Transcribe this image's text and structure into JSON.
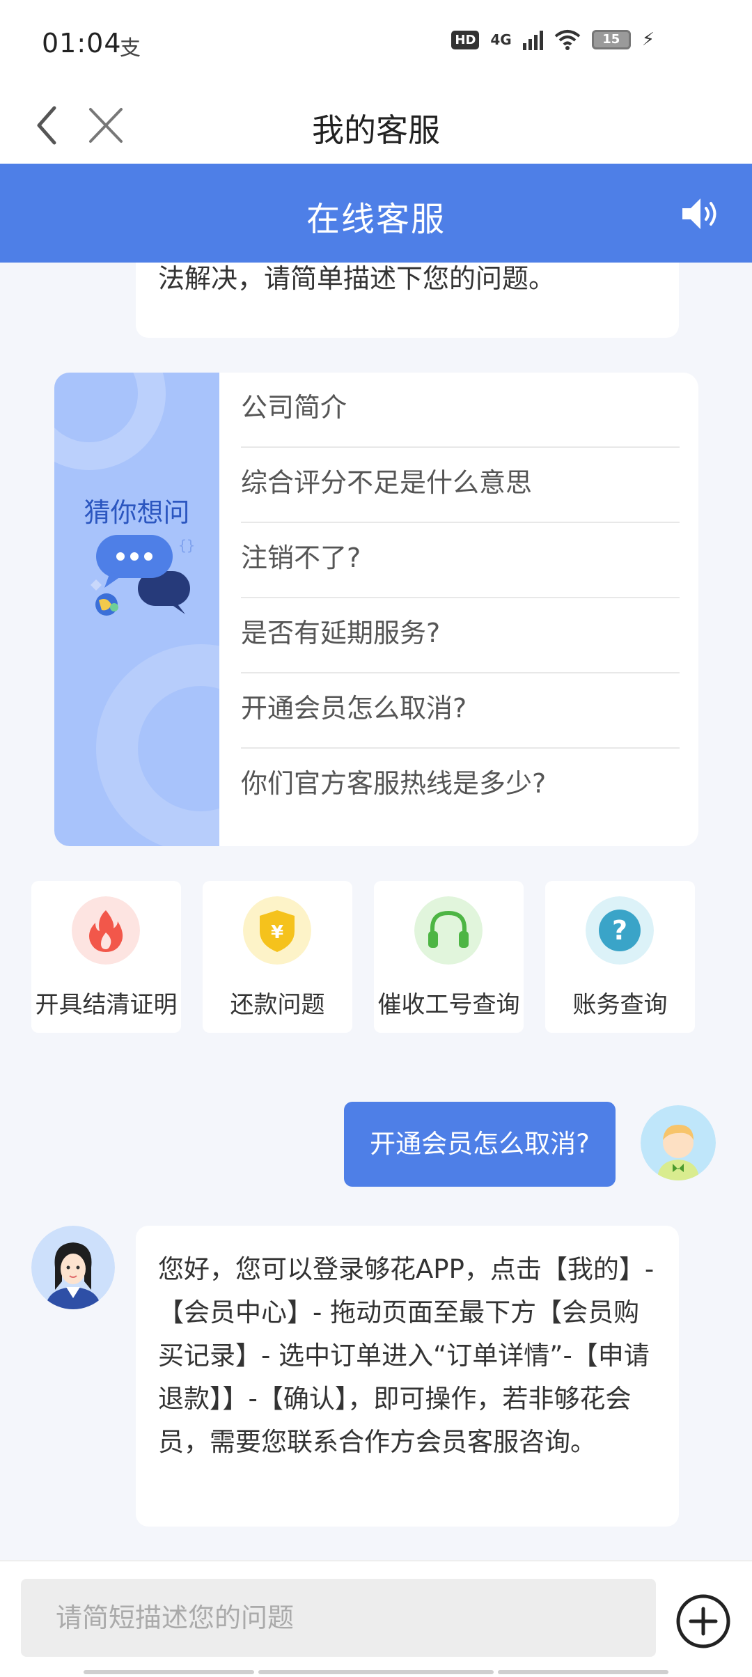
{
  "status_bar": {
    "time": "01:04",
    "alipay_icon": "支",
    "hd": "HD",
    "network": "4G",
    "battery": "15",
    "icons": [
      "alipay-icon",
      "hd-icon",
      "signal-icon",
      "wifi-icon",
      "battery-icon",
      "charging-icon"
    ]
  },
  "nav": {
    "title": "我的客服",
    "back_icon": "chevron-left-icon",
    "close_icon": "close-icon"
  },
  "header": {
    "title": "在线客服",
    "speaker_icon": "speaker-icon",
    "color": "#4e7fe7"
  },
  "chat": {
    "truncated_bot_message": "法解决，请简单描述下您的问题。",
    "faq": {
      "heading": "猜你想问",
      "items": [
        "公司简介",
        "综合评分不足是什么意思",
        "注销不了?",
        "是否有延期服务?",
        "开通会员怎么取消?",
        "你们官方客服热线是多少?"
      ]
    },
    "quick_actions": [
      {
        "label": "开具结清证明",
        "icon": "flame-icon",
        "color": "#f2574a",
        "bg": "#fde4e1"
      },
      {
        "label": "还款问题",
        "icon": "shield-yuan-icon",
        "color": "#f5c21c",
        "bg": "#fdf3c8"
      },
      {
        "label": "催收工号查询",
        "icon": "headset-icon",
        "color": "#4db544",
        "bg": "#e1f5dc"
      },
      {
        "label": "账务查询",
        "icon": "question-icon",
        "color": "#3aa4c8",
        "bg": "#dcf2f8"
      }
    ],
    "user_message": "开通会员怎么取消?",
    "agent_reply": "您好，您可以登录够花APP，点击【我的】-【会员中心】- 拖动页面至最下方【会员购买记录】- 选中订单进入“订单详情”-【申请退款】】-【确认】，即可操作，若非够花会员，需要您联系合作方会员客服咨询。"
  },
  "input": {
    "placeholder": "请简短描述您的问题",
    "value": "",
    "plus_icon": "plus-circle-icon"
  }
}
